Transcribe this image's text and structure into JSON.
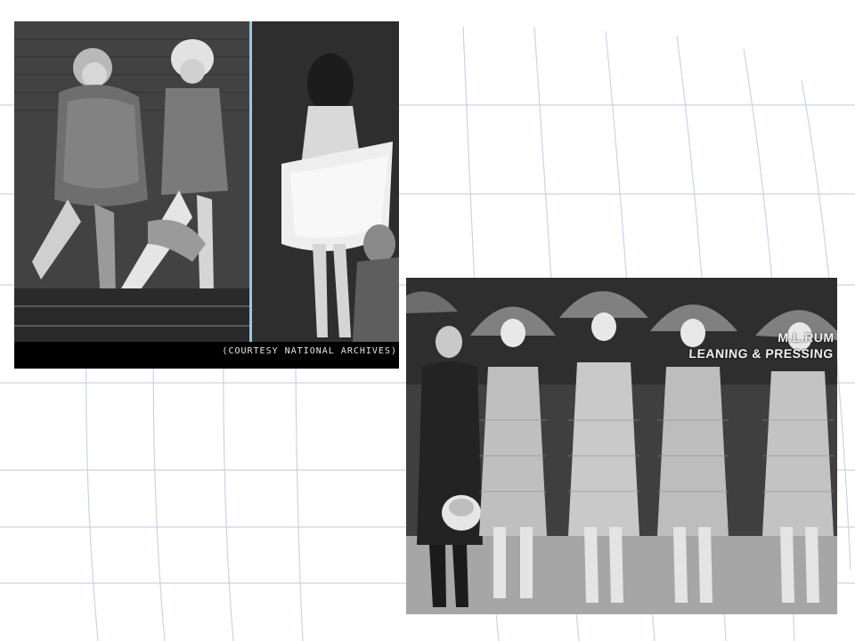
{
  "photos": [
    {
      "name": "flappers-dancing-photo",
      "caption": "(COURTESY NATIONAL ARCHIVES)"
    },
    {
      "name": "flappers-lineup-photo",
      "sign_lines": [
        "M.L.RUM",
        "LEANING & PRESSING"
      ]
    }
  ],
  "colors": {
    "background": "#ffffff",
    "grid_lines": "#c9d4e3"
  }
}
